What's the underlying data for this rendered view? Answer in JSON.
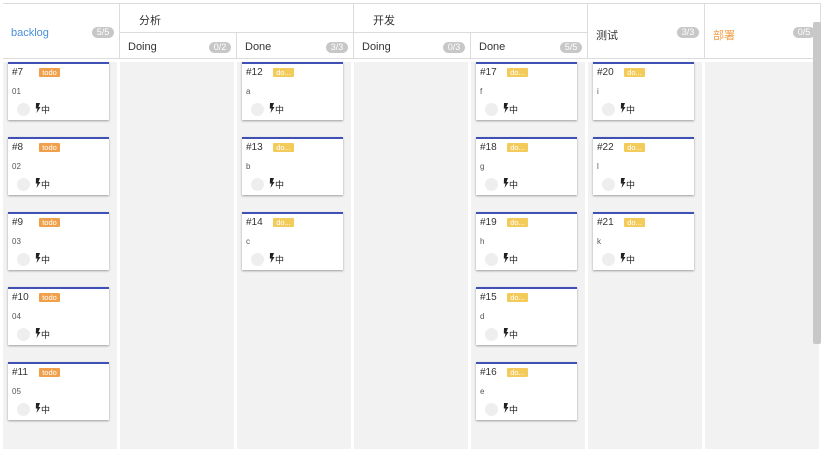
{
  "groups": {
    "analysis": "分析",
    "dev": "开发"
  },
  "columns": {
    "backlog": {
      "label": "backlog",
      "count": "5/5",
      "color": "#4a90d9"
    },
    "analysis_doing": {
      "label": "Doing",
      "count": "0/2"
    },
    "analysis_done": {
      "label": "Done",
      "count": "3/3"
    },
    "dev_doing": {
      "label": "Doing",
      "count": "0/3"
    },
    "dev_done": {
      "label": "Done",
      "count": "5/5"
    },
    "test": {
      "label": "测试",
      "count": "3/3"
    },
    "deploy": {
      "label": "部署",
      "count": "0/5",
      "color": "#f0a04a"
    }
  },
  "cards": {
    "backlog": [
      {
        "num": "#7",
        "tag": "todo",
        "title": "01",
        "priority": "中"
      },
      {
        "num": "#8",
        "tag": "todo",
        "title": "02",
        "priority": "中"
      },
      {
        "num": "#9",
        "tag": "todo",
        "title": "03",
        "priority": "中"
      },
      {
        "num": "#10",
        "tag": "todo",
        "title": "04",
        "priority": "中"
      },
      {
        "num": "#11",
        "tag": "todo",
        "title": "05",
        "priority": "中"
      }
    ],
    "analysis_done": [
      {
        "num": "#12",
        "tag": "do...",
        "title": "a",
        "priority": "中"
      },
      {
        "num": "#13",
        "tag": "do...",
        "title": "b",
        "priority": "中"
      },
      {
        "num": "#14",
        "tag": "do...",
        "title": "c",
        "priority": "中"
      }
    ],
    "dev_done": [
      {
        "num": "#17",
        "tag": "do...",
        "title": "f",
        "priority": "中"
      },
      {
        "num": "#18",
        "tag": "do...",
        "title": "g",
        "priority": "中"
      },
      {
        "num": "#19",
        "tag": "do...",
        "title": "h",
        "priority": "中"
      },
      {
        "num": "#15",
        "tag": "do...",
        "title": "d",
        "priority": "中"
      },
      {
        "num": "#16",
        "tag": "do...",
        "title": "e",
        "priority": "中"
      }
    ],
    "test": [
      {
        "num": "#20",
        "tag": "do...",
        "title": "i",
        "priority": "中"
      },
      {
        "num": "#22",
        "tag": "do...",
        "title": "l",
        "priority": "中"
      },
      {
        "num": "#21",
        "tag": "do...",
        "title": "k",
        "priority": "中"
      }
    ]
  },
  "colors": {
    "card_top_border": "#3f51b5",
    "todo_tag": "#f0a04a",
    "doing_tag": "#f3cb5a",
    "lane_bg": "#f2f2f2"
  }
}
